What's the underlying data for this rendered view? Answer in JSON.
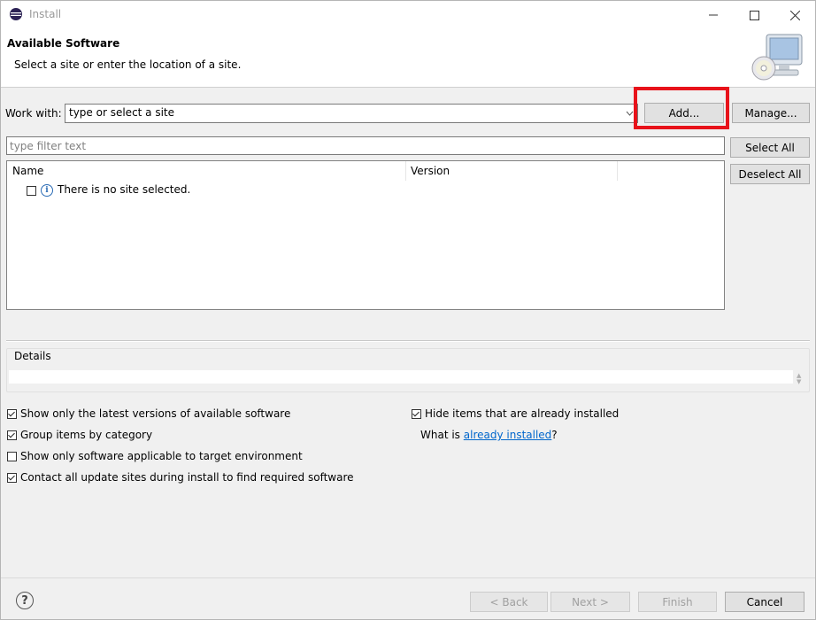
{
  "window": {
    "title": "Install"
  },
  "header": {
    "title": "Available Software",
    "subtitle": "Select a site or enter the location of a site."
  },
  "work_with": {
    "label": "Work with:",
    "combo_value": "type or select a site",
    "add_label": "Add...",
    "manage_label": "Manage..."
  },
  "filter": {
    "placeholder": "type filter text"
  },
  "side_buttons": {
    "select_all": "Select All",
    "deselect_all": "Deselect All"
  },
  "tree": {
    "columns": [
      "Name",
      "Version"
    ],
    "rows": [
      {
        "label": "There is no site selected.",
        "checked": false
      }
    ]
  },
  "details": {
    "label": "Details"
  },
  "options": {
    "latest_versions": {
      "label": "Show only the latest versions of available software",
      "checked": true
    },
    "group_by_category": {
      "label": "Group items by category",
      "checked": true
    },
    "applicable_target": {
      "label": "Show only software applicable to target environment",
      "checked": false
    },
    "contact_all_sites": {
      "label": "Contact all update sites during install to find required software",
      "checked": true
    },
    "hide_installed": {
      "label": "Hide items that are already installed",
      "checked": true
    },
    "what_is_prefix": "What is ",
    "what_is_link": "already installed",
    "what_is_suffix": "?"
  },
  "footer": {
    "back": "< Back",
    "next": "Next >",
    "finish": "Finish",
    "cancel": "Cancel"
  },
  "colors": {
    "highlight": "#e8121a",
    "link": "#0066cc"
  }
}
